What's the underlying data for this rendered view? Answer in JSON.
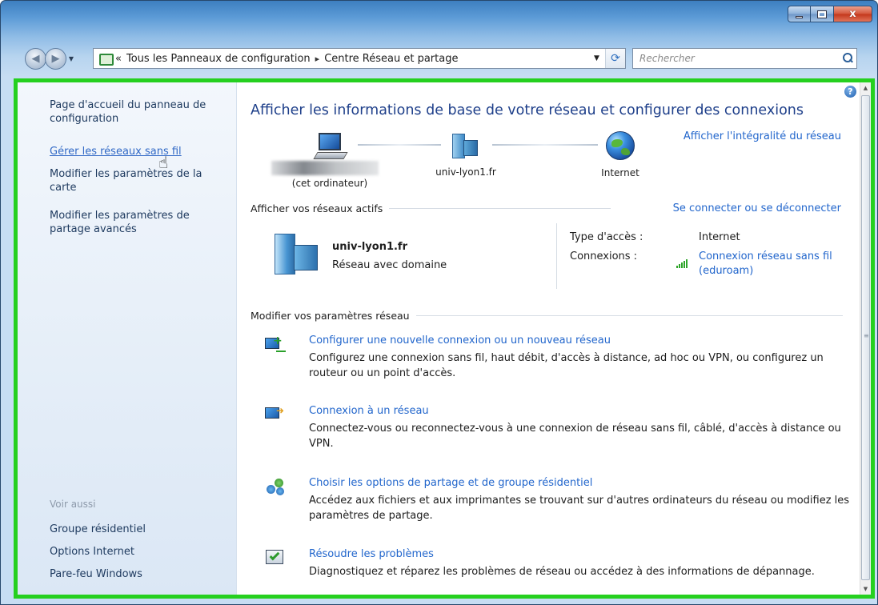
{
  "window": {
    "caption_buttons": {
      "minimize_icon": "minimize-icon",
      "maximize_icon": "maximize-icon",
      "close_glyph": "x"
    }
  },
  "navigation": {
    "back_glyph": "◀",
    "forward_glyph": "▶",
    "recent_glyph": "▼"
  },
  "address": {
    "overflow_glyph": "«",
    "breadcrumb": [
      "Tous les Panneaux de configuration",
      "Centre Réseau et partage"
    ],
    "separator_glyph": "▸",
    "dropdown_glyph": "▼",
    "refresh_glyph": "⟳"
  },
  "search": {
    "placeholder": "Rechercher"
  },
  "sidebar": {
    "home_link": "Page d'accueil du panneau de configuration",
    "items": [
      "Gérer les réseaux sans fil",
      "Modifier les paramètres de la carte",
      "Modifier les paramètres de partage avancés"
    ],
    "see_also_heading": "Voir aussi",
    "see_also": [
      "Groupe résidentiel",
      "Options Internet",
      "Pare-feu Windows"
    ],
    "cursor_glyph": "☝"
  },
  "help_glyph": "?",
  "main": {
    "title": "Afficher les informations de base de votre réseau et configurer des connexions",
    "full_map_link": "Afficher l'intégralité du réseau",
    "map_nodes": [
      "(cet ordinateur)",
      "univ-lyon1.fr",
      "Internet"
    ],
    "active_networks_heading": "Afficher vos réseaux actifs",
    "connect_disconnect_link": "Se connecter ou se déconnecter",
    "network": {
      "name": "univ-lyon1.fr",
      "category": "Réseau avec domaine",
      "access_type_label": "Type d'accès :",
      "access_type_value": "Internet",
      "connections_label": "Connexions :",
      "connection_name_line1": "Connexion réseau sans fil",
      "connection_name_line2": "(eduroam)"
    },
    "modify_heading": "Modifier vos paramètres réseau",
    "tasks": [
      {
        "icon": "new-connection-icon",
        "title": "Configurer une nouvelle connexion ou un nouveau réseau",
        "description": "Configurez une connexion sans fil, haut débit, d'accès à distance, ad hoc ou VPN, ou configurez un routeur ou un point d'accès."
      },
      {
        "icon": "connect-network-icon",
        "title": "Connexion à un réseau",
        "description": "Connectez-vous ou reconnectez-vous à une connexion de réseau sans fil, câblé, d'accès à distance ou VPN."
      },
      {
        "icon": "sharing-options-icon",
        "title": "Choisir les options de partage et de groupe résidentiel",
        "description": "Accédez aux fichiers et aux imprimantes se trouvant sur d'autres ordinateurs du réseau ou modifiez les paramètres de partage."
      },
      {
        "icon": "troubleshoot-icon",
        "title": "Résoudre les problèmes",
        "description": "Diagnostiquez et réparez les problèmes de réseau ou accédez à des informations de dépannage."
      }
    ]
  },
  "colors": {
    "highlight_border": "#25d01f",
    "link": "#2266cc",
    "title": "#1e3f8a"
  }
}
